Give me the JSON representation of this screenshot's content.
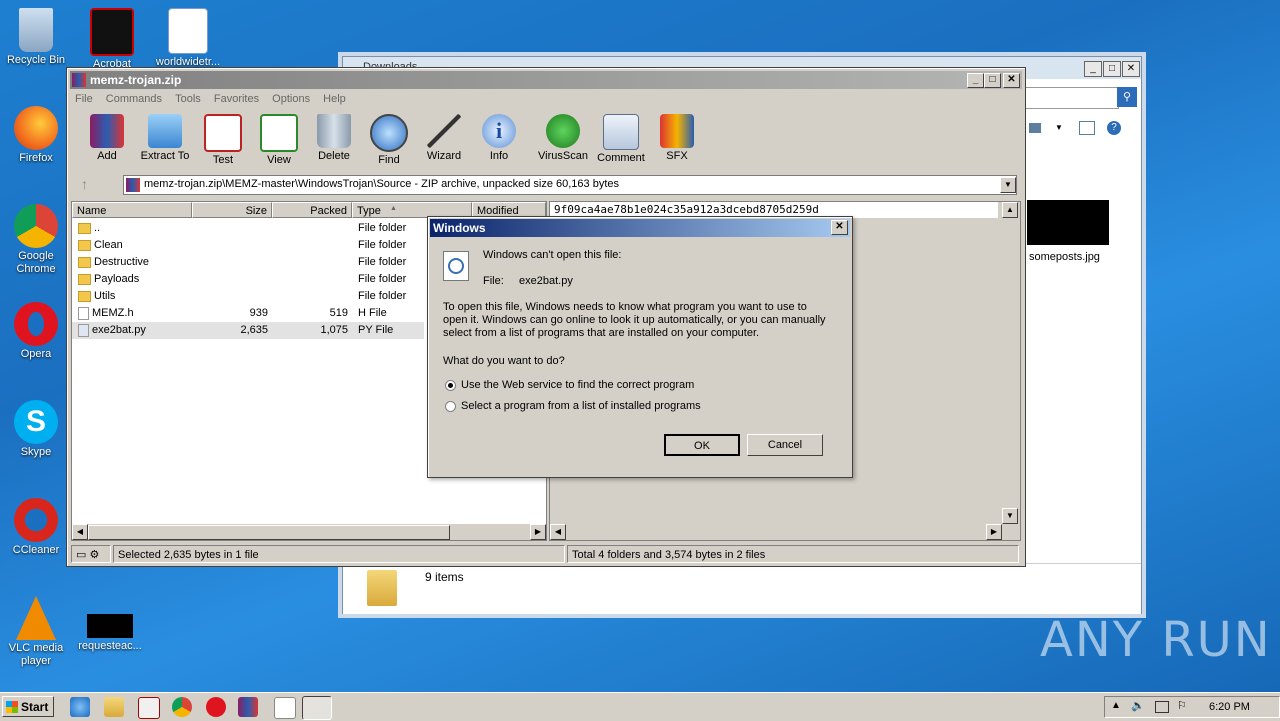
{
  "desktop": {
    "icons": [
      {
        "label": "Recycle Bin"
      },
      {
        "label": "Acrobat"
      },
      {
        "label": "worldwidetr..."
      },
      {
        "label": "Firefox"
      },
      {
        "label": "Google Chrome"
      },
      {
        "label": "Opera"
      },
      {
        "label": "Skype"
      },
      {
        "label": "CCleaner"
      },
      {
        "label": "VLC media player"
      },
      {
        "label": "requesteac..."
      }
    ],
    "watermark": "ANY RUN"
  },
  "explorer": {
    "title": "Downloads",
    "thumbnail_label": "someposts.jpg",
    "items_count": "9 items"
  },
  "winrar": {
    "title": "memz-trojan.zip",
    "menu": [
      "File",
      "Commands",
      "Tools",
      "Favorites",
      "Options",
      "Help"
    ],
    "toolbar": [
      "Add",
      "Extract To",
      "Test",
      "View",
      "Delete",
      "Find",
      "Wizard",
      "Info",
      "VirusScan",
      "Comment",
      "SFX"
    ],
    "path": "memz-trojan.zip\\MEMZ-master\\WindowsTrojan\\Source - ZIP archive, unpacked size 60,163 bytes",
    "columns": [
      "Name",
      "Size",
      "Packed",
      "Type",
      "Modified"
    ],
    "files": [
      {
        "name": "..",
        "size": "",
        "packed": "",
        "type": "File folder"
      },
      {
        "name": "Clean",
        "size": "",
        "packed": "",
        "type": "File folder"
      },
      {
        "name": "Destructive",
        "size": "",
        "packed": "",
        "type": "File folder"
      },
      {
        "name": "Payloads",
        "size": "",
        "packed": "",
        "type": "File folder"
      },
      {
        "name": "Utils",
        "size": "",
        "packed": "",
        "type": "File folder"
      },
      {
        "name": "MEMZ.h",
        "size": "939",
        "packed": "519",
        "type": "H File"
      },
      {
        "name": "exe2bat.py",
        "size": "2,635",
        "packed": "1,075",
        "type": "PY File"
      }
    ],
    "preview_hash": "9f09ca4ae78b1e024c35a912a3dcebd8705d259d",
    "status_left": "Selected 2,635 bytes in 1 file",
    "status_right": "Total 4 folders and 3,574 bytes in 2 files"
  },
  "dialog": {
    "title": "Windows",
    "heading": "Windows can't open this file:",
    "file_label": "File:",
    "file_name": "exe2bat.py",
    "body": "To open this file, Windows needs to know what program you want to use to open it. Windows can go online to look it up automatically, or you can manually select from a list of programs that are installed on your computer.",
    "question": "What do you want to do?",
    "option1": "Use the Web service to find the correct program",
    "option2": "Select a program from a list of installed programs",
    "ok": "OK",
    "cancel": "Cancel"
  },
  "taskbar": {
    "start": "Start",
    "clock": "6:20 PM"
  }
}
